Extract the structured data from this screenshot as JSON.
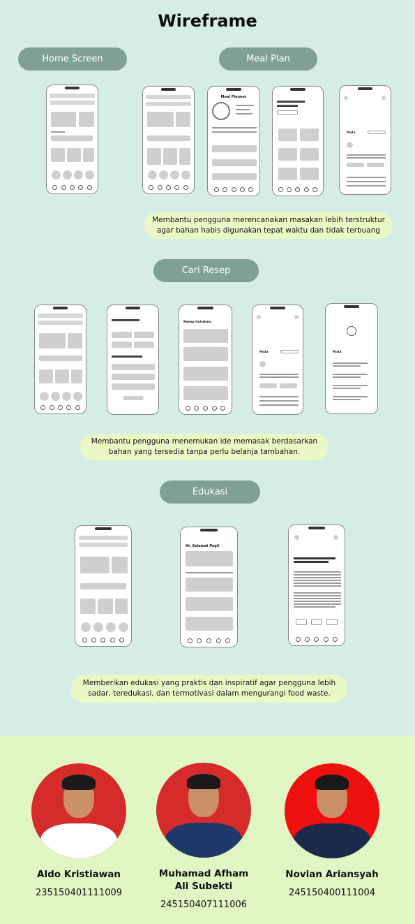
{
  "title": "Wireframe",
  "sections": {
    "home_screen": "Home Screen",
    "meal_plan": "Meal Plan",
    "cari_resep": "Cari Resep",
    "edukasi": "Edukasi"
  },
  "descriptions": {
    "meal_plan": "Membantu pengguna merencanakan masakan lebih terstruktur agar bahan habis digunakan tepat waktu dan tidak terbuang",
    "cari_resep": "Membantu pengguna menemukan ide memasak berdasarkan bahan yang tersedia tanpa perlu belanja tambahan.",
    "edukasi": "Memberikan edukasi yang praktis dan inspiratif agar pengguna lebih sadar, teredukasi, dan termotivasi dalam mengurangi food waste."
  },
  "wireframe_labels": {
    "meal_planner": "Meal Planner",
    "pasta": "Pasta",
    "resep_untukmu": "Resep Untukmu",
    "greeting": "Hi, Selamat Pagi!"
  },
  "team": [
    {
      "name": "Aldo Kristiawan",
      "id": "235150401111009",
      "bg": "#d62b2b",
      "suit": "#ffffff"
    },
    {
      "name": "Muhamad Afham Ali Subekti",
      "id": "245150407111006",
      "bg": "#d62b2b",
      "suit": "#1f3a6a"
    },
    {
      "name": "Novian Ariansyah",
      "id": "245150400111004",
      "bg": "#ef1010",
      "suit": "#1b2a4a"
    }
  ]
}
